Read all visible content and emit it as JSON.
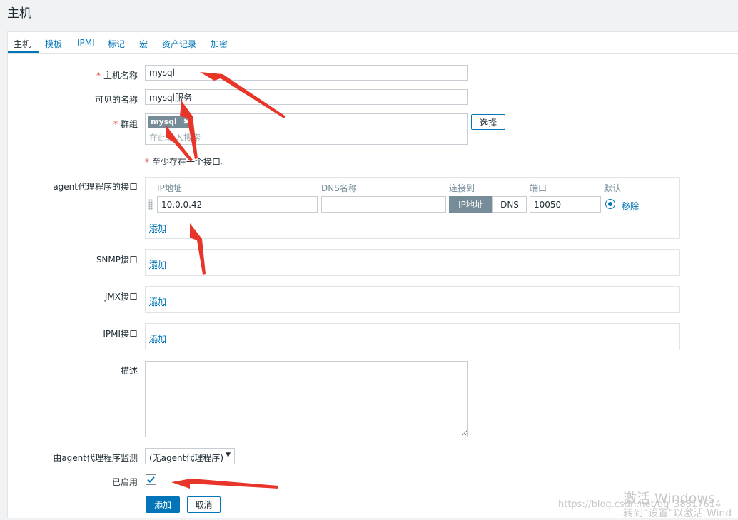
{
  "page": {
    "title": "主机"
  },
  "tabs": [
    "主机",
    "模板",
    "IPMI",
    "标记",
    "宏",
    "资产记录",
    "加密"
  ],
  "form": {
    "host_name": {
      "label": "主机名称",
      "value": "mysql"
    },
    "visible_name": {
      "label": "可见的名称",
      "value": "mysql服务"
    },
    "groups": {
      "label": "群组",
      "tag": "mysql",
      "tag_remove": "✖",
      "placeholder": "在此输入搜索",
      "select_button": "选择"
    },
    "interface_note": "至少存在一个接口。",
    "required_mark": "*",
    "agent_interface": {
      "label": "agent代理程序的接口",
      "headers": {
        "ip": "IP地址",
        "dns": "DNS名称",
        "connect": "连接到",
        "port": "端口",
        "default": "默认"
      },
      "ip_value": "10.0.0.42",
      "dns_value": "",
      "connect_ip": "IP地址",
      "connect_dns": "DNS",
      "port_value": "10050",
      "remove": "移除",
      "add": "添加"
    },
    "snmp_interface": {
      "label": "SNMP接口",
      "add": "添加"
    },
    "jmx_interface": {
      "label": "JMX接口",
      "add": "添加"
    },
    "ipmi_interface": {
      "label": "IPMI接口",
      "add": "添加"
    },
    "description": {
      "label": "描述",
      "value": ""
    },
    "proxy": {
      "label": "由agent代理程序监测",
      "value": "(无agent代理程序)"
    },
    "enabled": {
      "label": "已启用",
      "checked": true
    },
    "buttons": {
      "add": "添加",
      "cancel": "取消"
    }
  },
  "watermark": {
    "line1": "激活 Windows",
    "line2": "转到“设置”以激活 Wind",
    "url": "https://blog.csdn.net/qq_38817614"
  },
  "colors": {
    "accent": "#0275b8",
    "required": "#e33734",
    "arrow": "#e8352a"
  }
}
